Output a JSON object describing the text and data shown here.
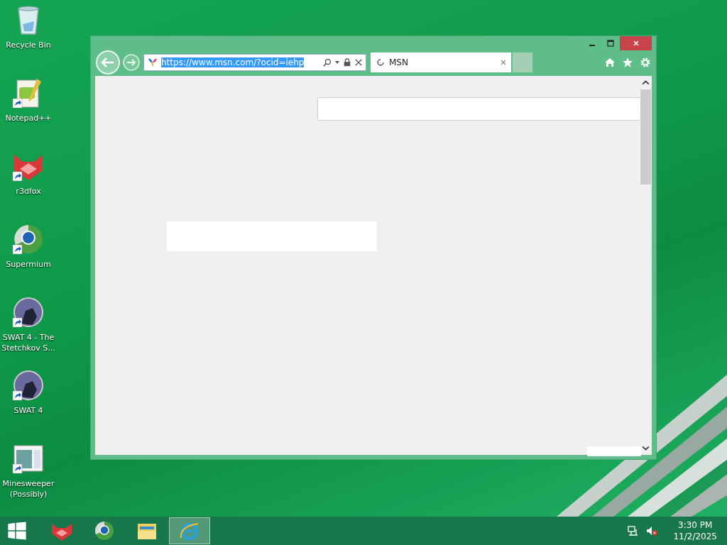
{
  "desktop_icons": [
    {
      "label": "Recycle Bin",
      "kind": "recycle",
      "shortcut": false
    },
    {
      "label": "Notepad++",
      "kind": "notepad",
      "shortcut": true
    },
    {
      "label": "r3dfox",
      "kind": "fox",
      "shortcut": true
    },
    {
      "label": "Supermium",
      "kind": "supermium",
      "shortcut": true
    },
    {
      "label": "SWAT 4 - The Stetchkov S...",
      "kind": "swat",
      "shortcut": true
    },
    {
      "label": "SWAT 4",
      "kind": "swat",
      "shortcut": true
    },
    {
      "label": "Minesweeper (Possibly)",
      "kind": "window",
      "shortcut": true
    }
  ],
  "browser": {
    "address": "https://www.msn.com/?ocid=iehp",
    "address_selected": true,
    "tabs": [
      {
        "label": "MSN",
        "selected": true,
        "loading": true
      }
    ]
  },
  "taskbar": {
    "apps": [
      {
        "kind": "fox",
        "selected": false
      },
      {
        "kind": "supermium",
        "selected": false
      },
      {
        "kind": "folder",
        "selected": false
      },
      {
        "kind": "ie",
        "selected": true
      }
    ],
    "volume_muted": true,
    "time": "3:30 PM",
    "date": "11/2/2025"
  }
}
